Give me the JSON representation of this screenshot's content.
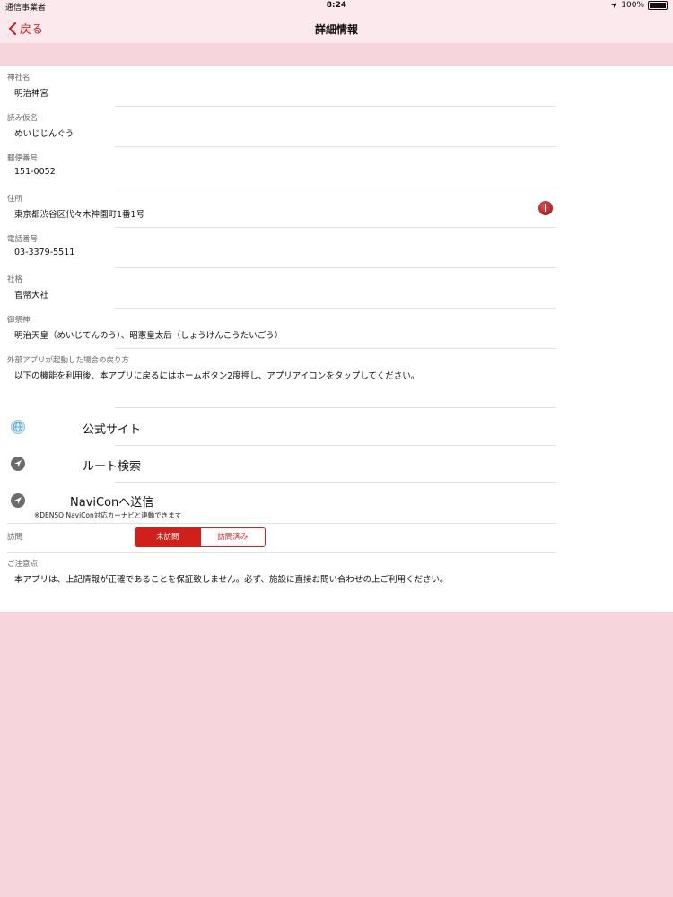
{
  "status_bar": {
    "carrier": "通信事業者",
    "time": "8:24",
    "battery": "100%"
  },
  "nav": {
    "back_label": "戻る",
    "title": "詳細情報"
  },
  "fields": [
    {
      "label": "神社名",
      "value": "明治神宮"
    },
    {
      "label": "読み仮名",
      "value": "めいじじんぐう"
    },
    {
      "label": "郵便番号",
      "value": "151-0052"
    },
    {
      "label": "住所",
      "value": "東京都渋谷区代々木神園町1番1号"
    },
    {
      "label": "電話番号",
      "value": "03-3379-5511"
    },
    {
      "label": "社格",
      "value": "官幣大社"
    },
    {
      "label": "御祭神",
      "value": "明治天皇（めいじてんのう）、昭憲皇太后（しょうけんこうたいごう）"
    },
    {
      "label": "外部アプリが起動した場合の戻り方",
      "value": "以下の機能を利用後、本アプリに戻るにはホームボタン2度押し、アプリアイコンをタップしてください。"
    }
  ],
  "actions": {
    "official_site": "公式サイト",
    "route_search": "ルート検索",
    "navicon": "NaviConへ送信",
    "navicon_note": "※DENSO NaviCon対応カーナビと連動できます"
  },
  "visit": {
    "label": "訪問",
    "options": [
      "未訪問",
      "訪問済み"
    ],
    "selected": "未訪問"
  },
  "notice": {
    "label": "ご注意点",
    "text": "本アプリは、上記情報が正確であることを保証致しません。必ず、施設に直接お問い合わせの上ご利用ください。"
  },
  "colors": {
    "accent": "#d0201b",
    "background_pink": "#f6d5dc",
    "navbar": "#fbe9ee"
  },
  "icons": [
    "wifi-icon",
    "location-arrow-icon",
    "battery-icon",
    "back-chevron-icon",
    "map-pin-icon",
    "globe-icon",
    "navigation-arrow-icon"
  ]
}
